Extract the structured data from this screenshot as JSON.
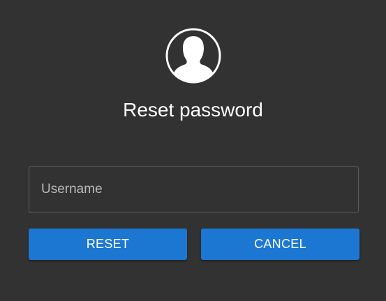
{
  "form": {
    "title": "Reset password",
    "username_placeholder": "Username",
    "username_value": "",
    "reset_label": "RESET",
    "cancel_label": "CANCEL"
  },
  "icons": {
    "avatar": "user-silhouette-icon"
  },
  "colors": {
    "background": "#323232",
    "accent": "#1c77d2",
    "text": "#ffffff",
    "field_border": "#5c5c5c",
    "placeholder": "#b9b9b9"
  }
}
